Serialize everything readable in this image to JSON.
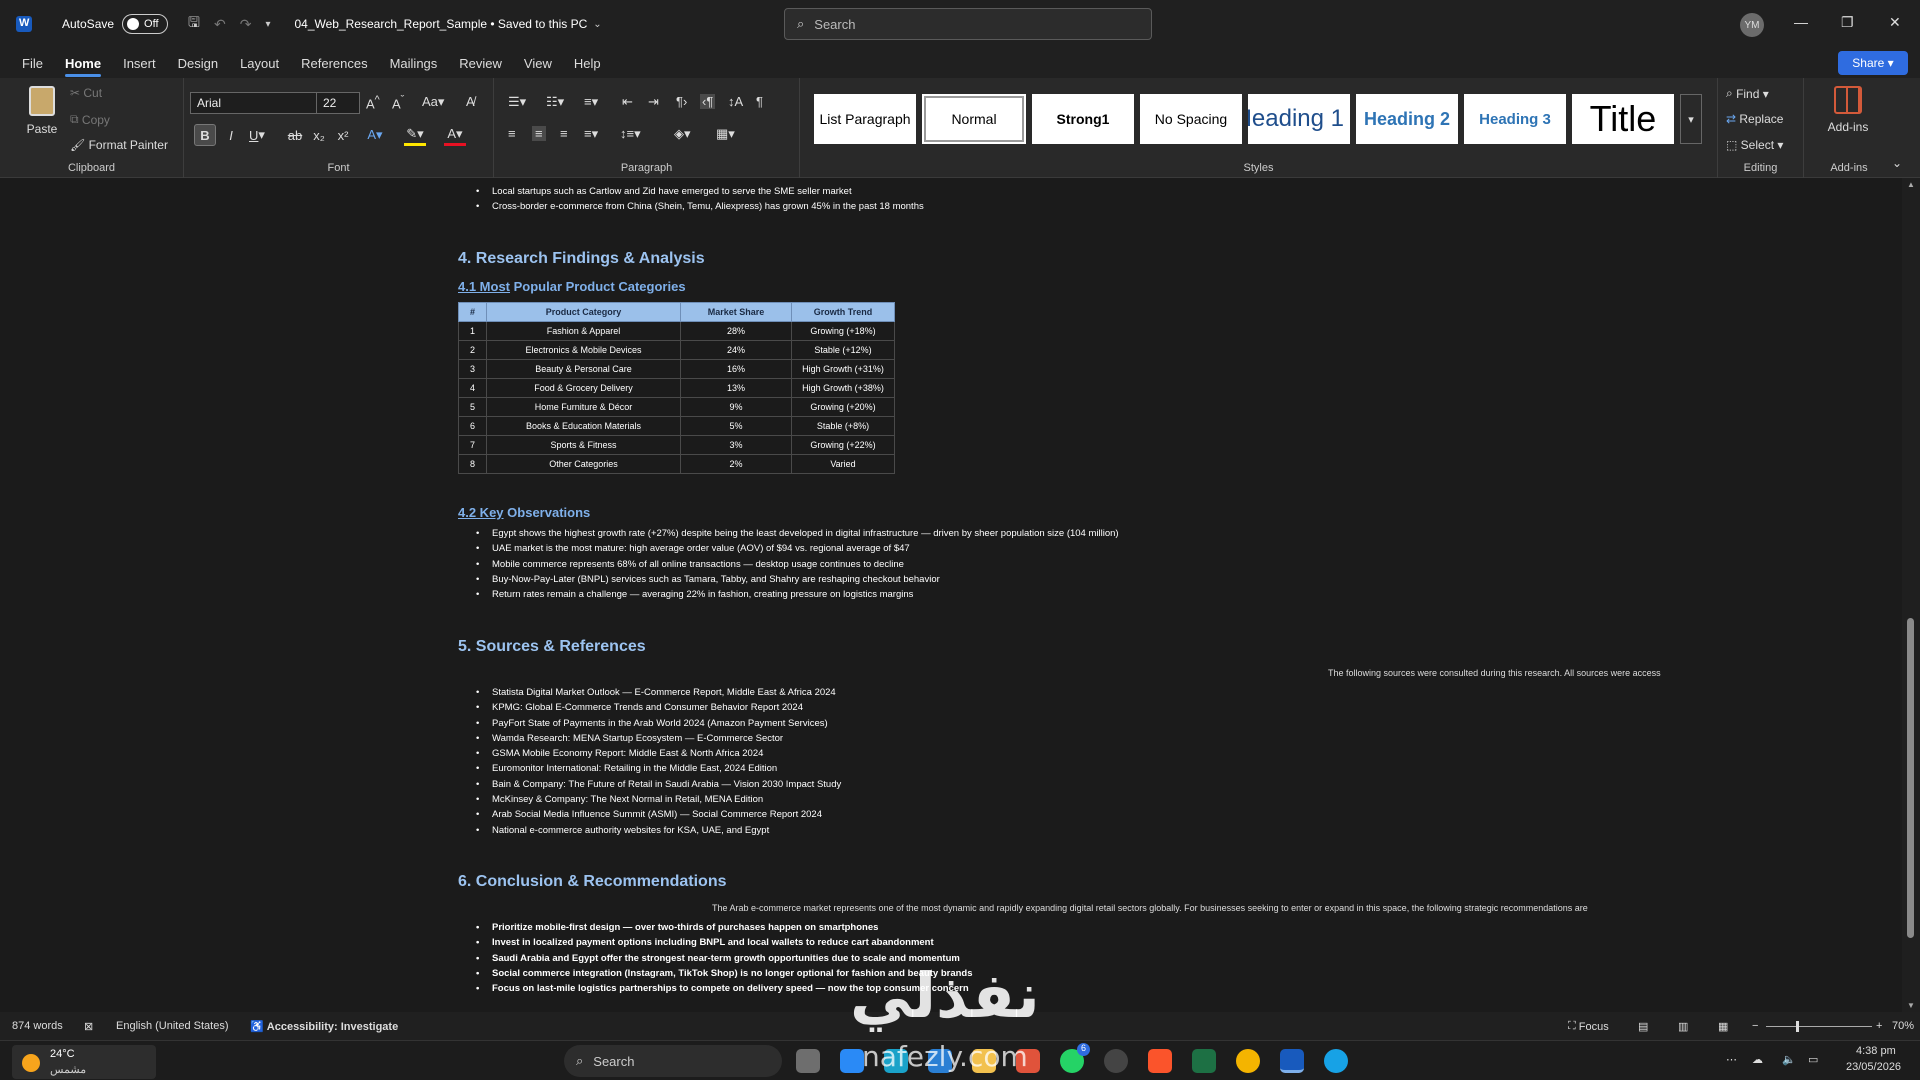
{
  "titlebar": {
    "autosave_label": "AutoSave",
    "autosave_state": "Off",
    "doc_title": "04_Web_Research_Report_Sample • Saved to this PC",
    "search_placeholder": "Search",
    "avatar_initials": "YM"
  },
  "menu": [
    "File",
    "Home",
    "Insert",
    "Design",
    "Layout",
    "References",
    "Mailings",
    "Review",
    "View",
    "Help"
  ],
  "share_label": "Share",
  "ribbon": {
    "clipboard": {
      "paste": "Paste",
      "cut": "Cut",
      "copy": "Copy",
      "format_painter": "Format Painter",
      "label": "Clipboard"
    },
    "font": {
      "family": "Arial",
      "size": "22",
      "label": "Font"
    },
    "paragraph": {
      "label": "Paragraph"
    },
    "styles": {
      "items": [
        "List Paragraph",
        "Normal",
        "Strong1",
        "No Spacing",
        "Heading 1",
        "Heading 2",
        "Heading 3",
        "Title"
      ],
      "label": "Styles"
    },
    "editing": {
      "find": "Find",
      "replace": "Replace",
      "select": "Select",
      "label": "Editing"
    },
    "addins": {
      "button": "Add-ins",
      "label": "Add-ins"
    }
  },
  "document": {
    "top_bullets": [
      "Local startups such as Cartlow and Zid have emerged to serve the SME seller market",
      "Cross-border e-commerce from China (Shein, Temu, Aliexpress) has grown 45% in the past 18 months"
    ],
    "section4": {
      "title": "4.  Research Findings & Analysis",
      "sub1_num": "4.1  Most",
      "sub1_rest": " Popular Product Categories",
      "table": {
        "headers": [
          "#",
          "Product Category",
          "Market Share",
          "Growth Trend"
        ],
        "rows": [
          [
            "1",
            "Fashion & Apparel",
            "28%",
            "Growing (+18%)"
          ],
          [
            "2",
            "Electronics & Mobile Devices",
            "24%",
            "Stable (+12%)"
          ],
          [
            "3",
            "Beauty & Personal Care",
            "16%",
            "High Growth (+31%)"
          ],
          [
            "4",
            "Food & Grocery Delivery",
            "13%",
            "High Growth (+38%)"
          ],
          [
            "5",
            "Home Furniture & Décor",
            "9%",
            "Growing (+20%)"
          ],
          [
            "6",
            "Books & Education Materials",
            "5%",
            "Stable (+8%)"
          ],
          [
            "7",
            "Sports & Fitness",
            "3%",
            "Growing (+22%)"
          ],
          [
            "8",
            "Other Categories",
            "2%",
            "Varied"
          ]
        ]
      },
      "sub2_num": "4.2  Key",
      "sub2_rest": " Observations",
      "observations": [
        "Egypt shows the highest growth rate (+27%) despite being the least developed in digital infrastructure — driven by sheer population size (104 million)",
        "UAE market is the most mature: high average order value (AOV) of $94 vs. regional average of $47",
        "Mobile commerce represents 68% of all online transactions — desktop usage continues to decline",
        "Buy-Now-Pay-Later (BNPL) services such as Tamara, Tabby, and Shahry are reshaping checkout behavior",
        "Return rates remain a challenge — averaging 22% in fashion, creating pressure on logistics margins"
      ]
    },
    "section5": {
      "title": "5.  Sources & References",
      "lead": "The following sources were consulted during this research. All sources were access",
      "sources": [
        "Statista Digital Market Outlook — E-Commerce Report, Middle East & Africa 2024",
        "KPMG: Global E-Commerce Trends and Consumer Behavior Report 2024",
        "PayFort State of Payments in the Arab World 2024 (Amazon Payment Services)",
        "Wamda Research: MENA Startup Ecosystem — E-Commerce Sector",
        "GSMA Mobile Economy Report: Middle East & North Africa 2024",
        "Euromonitor International: Retailing in the Middle East, 2024 Edition",
        "Bain & Company: The Future of Retail in Saudi Arabia — Vision 2030 Impact Study",
        "McKinsey & Company: The Next Normal in Retail, MENA Edition",
        "Arab Social Media Influence Summit (ASMI) — Social Commerce Report 2024",
        "National e-commerce authority websites for KSA, UAE, and Egypt"
      ]
    },
    "section6": {
      "title": "6.  Conclusion & Recommendations",
      "lead": "The Arab e-commerce market represents one of the most dynamic and rapidly expanding digital retail sectors globally. For businesses seeking to enter or expand in this space, the following strategic recommendations are",
      "recommendations": [
        "Prioritize mobile-first design — over two-thirds of purchases happen on smartphones",
        "Invest in localized payment options including BNPL and local wallets to reduce cart abandonment",
        "Saudi Arabia and Egypt offer the strongest near-term growth opportunities due to scale and momentum",
        "Social commerce integration (Instagram, TikTok Shop) is no longer optional for fashion and beauty brands",
        "Focus on last-mile logistics partnerships to compete on delivery speed — now the top consumer concern"
      ]
    }
  },
  "statusbar": {
    "words": "874 words",
    "language": "English (United States)",
    "accessibility": "Accessibility: Investigate",
    "focus": "Focus",
    "zoom": "70%"
  },
  "taskbar": {
    "temp": "24°C",
    "condition": "مشمس",
    "search": "Search",
    "time": "4:38 pm",
    "date": "23/05/2026",
    "badge": "6"
  },
  "watermark": {
    "arabic": "نفذلي",
    "latin": "nafezly.com"
  },
  "colors": {
    "accent": "#4a8fe7",
    "heading": "#9cc3f0",
    "table_header": "#9bc0ea"
  }
}
